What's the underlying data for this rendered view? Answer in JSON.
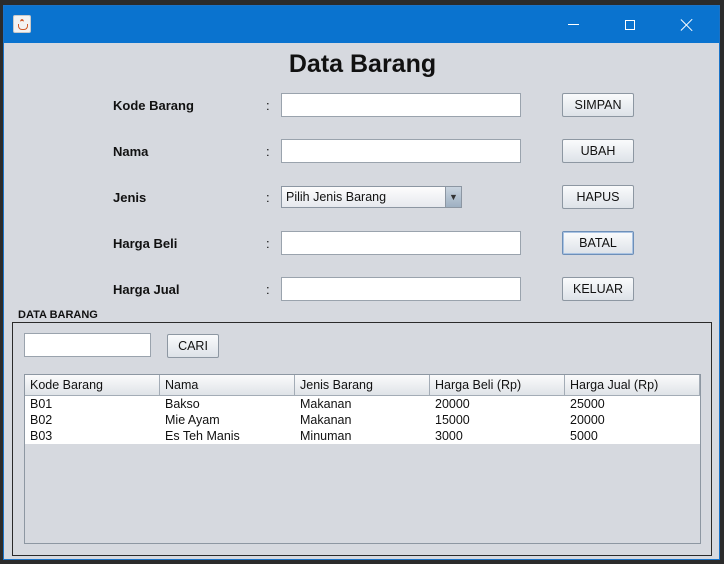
{
  "window": {
    "title": ""
  },
  "form": {
    "heading": "Data Barang",
    "fields": [
      {
        "label": "Kode Barang",
        "value": ""
      },
      {
        "label": "Nama",
        "value": ""
      },
      {
        "label": "Jenis",
        "value": "Pilih Jenis Barang"
      },
      {
        "label": "Harga Beli",
        "value": ""
      },
      {
        "label": "Harga Jual",
        "value": ""
      }
    ],
    "colon": ":",
    "buttons": {
      "simpan": "SIMPAN",
      "ubah": "UBAH",
      "hapus": "HAPUS",
      "batal": "BATAL",
      "keluar": "KELUAR"
    }
  },
  "table_section": {
    "title": "DATA BARANG",
    "search": {
      "value": "",
      "button": "CARI"
    },
    "columns": [
      "Kode Barang",
      "Nama",
      "Jenis Barang",
      "Harga Beli (Rp)",
      "Harga Jual (Rp)"
    ],
    "rows": [
      [
        "B01",
        "Bakso",
        "Makanan",
        "20000",
        "25000"
      ],
      [
        "B02",
        "Mie Ayam",
        "Makanan",
        "15000",
        "20000"
      ],
      [
        "B03",
        "Es Teh Manis",
        "Minuman",
        "3000",
        "5000"
      ]
    ]
  },
  "icons": {
    "app": "java-cup-icon",
    "minimize": "minimize-icon",
    "maximize": "maximize-icon",
    "close": "close-icon"
  },
  "colors": {
    "titlebar": "#0a73cf",
    "window_bg": "#d6d9df"
  }
}
